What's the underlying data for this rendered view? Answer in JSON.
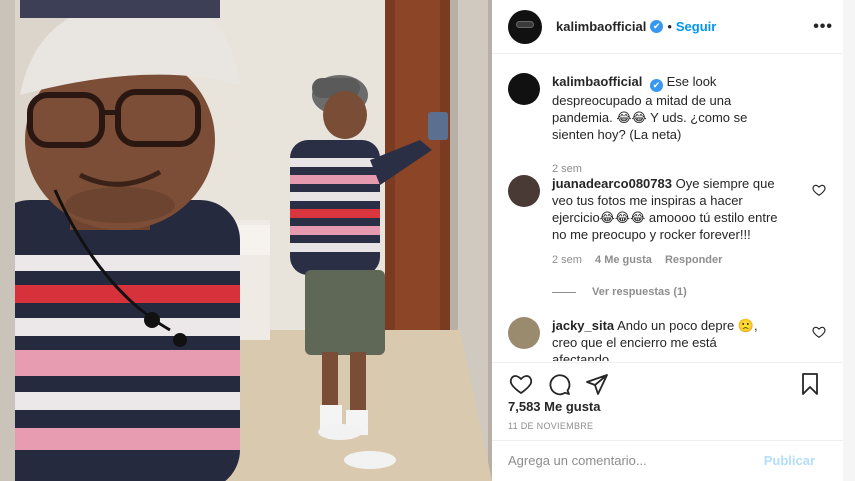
{
  "header": {
    "username": "kalimbaofficial",
    "verified_mark": "✔",
    "separator": "•",
    "follow_label": "Seguir",
    "more_label": "•••"
  },
  "caption": {
    "username": "kalimbaofficial",
    "verified_mark": "✔",
    "text": "Ese look despreocupado a mitad de una pandemia. 😂😂 Y uds. ¿como se sienten hoy? (La neta)",
    "time": "2 sem"
  },
  "comments": [
    {
      "username": "juanadearco080783",
      "text": "Oye siempre que veo tus fotos me inspiras a hacer ejercicio😂😂😂 amoooo tú estilo entre no me preocupo y rocker forever!!!",
      "time": "2 sem",
      "likes": "4 Me gusta",
      "reply_label": "Responder",
      "view_replies": "Ver respuestas (1)"
    },
    {
      "username": "jacky_sita",
      "text": "Ando un poco depre 🙁, creo que el encierro me está afectando..."
    }
  ],
  "post": {
    "likes": "7,583 Me gusta",
    "date": "11 DE NOVIEMBRE"
  },
  "add_comment": {
    "placeholder": "Agrega un comentario...",
    "publish_label": "Publicar"
  },
  "icons": {
    "like": "heart-icon",
    "comment": "comment-icon",
    "share": "share-icon",
    "save": "bookmark-icon",
    "more": "more-icon",
    "verified": "verified-badge-icon"
  },
  "colors": {
    "accent": "#0095f6",
    "verified": "#3897f0",
    "muted": "#8e8e8e",
    "publish_disabled": "#b2dffc"
  }
}
